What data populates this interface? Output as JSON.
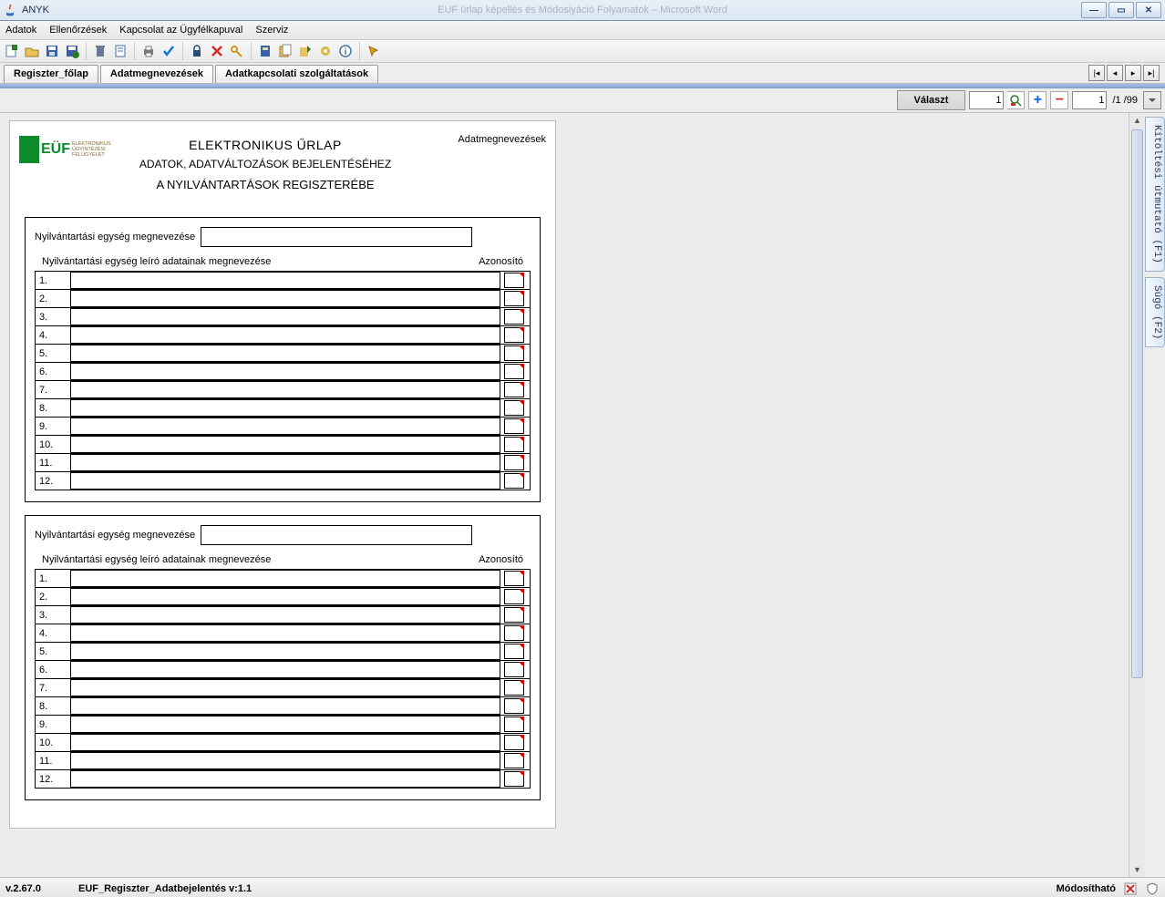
{
  "window": {
    "title": "ANYK",
    "faded_title": "EUF ürlap képellés és Módosiyáció Folyamatok – Microsoft Word"
  },
  "menu": {
    "items": [
      "Adatok",
      "Ellenőrzések",
      "Kapcsolat az Ügyfélkapuval",
      "Szerviz"
    ]
  },
  "tabs": {
    "t1": "Regiszter_főlap",
    "t2": "Adatmegnevezések",
    "t3": "Adatkapcsolati szolgáltatások",
    "active": 1
  },
  "nav": {
    "first": "|◀",
    "prev": "◀",
    "next": "▶",
    "last": "▶|"
  },
  "controls": {
    "valaszt": "Választ",
    "num1": "1",
    "num2": "1",
    "pagesuffix": "/1 /99"
  },
  "sidetabs": {
    "guide": "Kitöltési útmutató (F1)",
    "help": "Súgó (F2)"
  },
  "form": {
    "title_line1": "ELEKTRONIKUS ŰRLAP",
    "title_line2": "ADATOK, ADATVÁLTOZÁSOK BEJELENTÉSÉHEZ",
    "title_line3": "A NYILVÁNTARTÁSOK REGISZTERÉBE",
    "corner_label": "Adatmegnevezések",
    "logo_main": "EÜF",
    "logo_sub1": "ELEKTRONIKUS",
    "logo_sub2": "ÜGYINTÉZÉSI",
    "logo_sub3": "FELÜGYELET",
    "unit_name_label": "Nyilvántartási egység megnevezése",
    "unit_sub_label": "Nyilvántartási egység leíró adatainak megnevezése",
    "azon_label": "Azonosító",
    "rows": [
      "1.",
      "2.",
      "3.",
      "4.",
      "5.",
      "6.",
      "7.",
      "8.",
      "9.",
      "10.",
      "11.",
      "12."
    ]
  },
  "status": {
    "version": "v.2.67.0",
    "form_version": "EUF_Regiszter_Adatbejelentés v:1.1",
    "state": "Módosítható"
  }
}
